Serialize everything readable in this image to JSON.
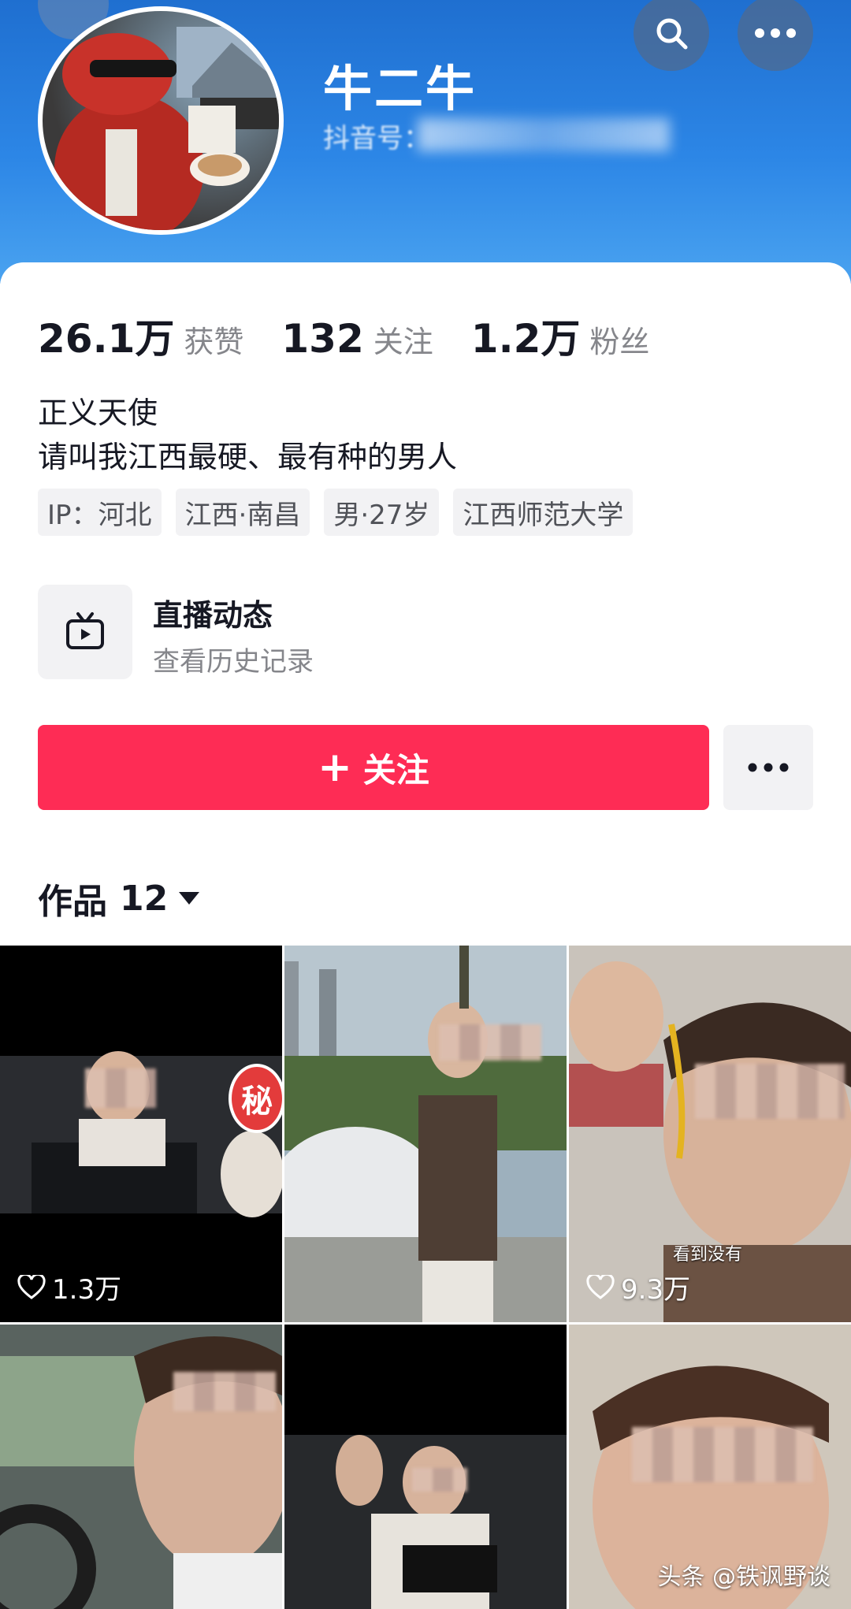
{
  "profile": {
    "name": "牛二牛",
    "douyin_id": "抖音号："
  },
  "stats": [
    {
      "value": "26.1万",
      "label": "获赞"
    },
    {
      "value": "132",
      "label": "关注"
    },
    {
      "value": "1.2万",
      "label": "粉丝"
    }
  ],
  "bio": {
    "line1": "正义天使",
    "line2": "请叫我江西最硬、最有种的男人"
  },
  "tags": [
    "IP：河北",
    "江西·南昌",
    "男·27岁",
    "江西师范大学"
  ],
  "live": {
    "title": "直播动态",
    "subtitle": "查看历史记录"
  },
  "actions": {
    "follow_plus": "+",
    "follow_label": "关注"
  },
  "works": {
    "label": "作品",
    "count": "12"
  },
  "videos": [
    {
      "likes": "1.3万",
      "badge": "秘"
    },
    {
      "likes": ""
    },
    {
      "likes": "9.3万",
      "caption": "看到没有"
    },
    {
      "likes": ""
    },
    {
      "likes": ""
    },
    {
      "likes": ""
    }
  ],
  "watermark": "头条 @铁讽野谈",
  "colors": {
    "accent": "#fe2c55",
    "header": "#2c86e6"
  }
}
